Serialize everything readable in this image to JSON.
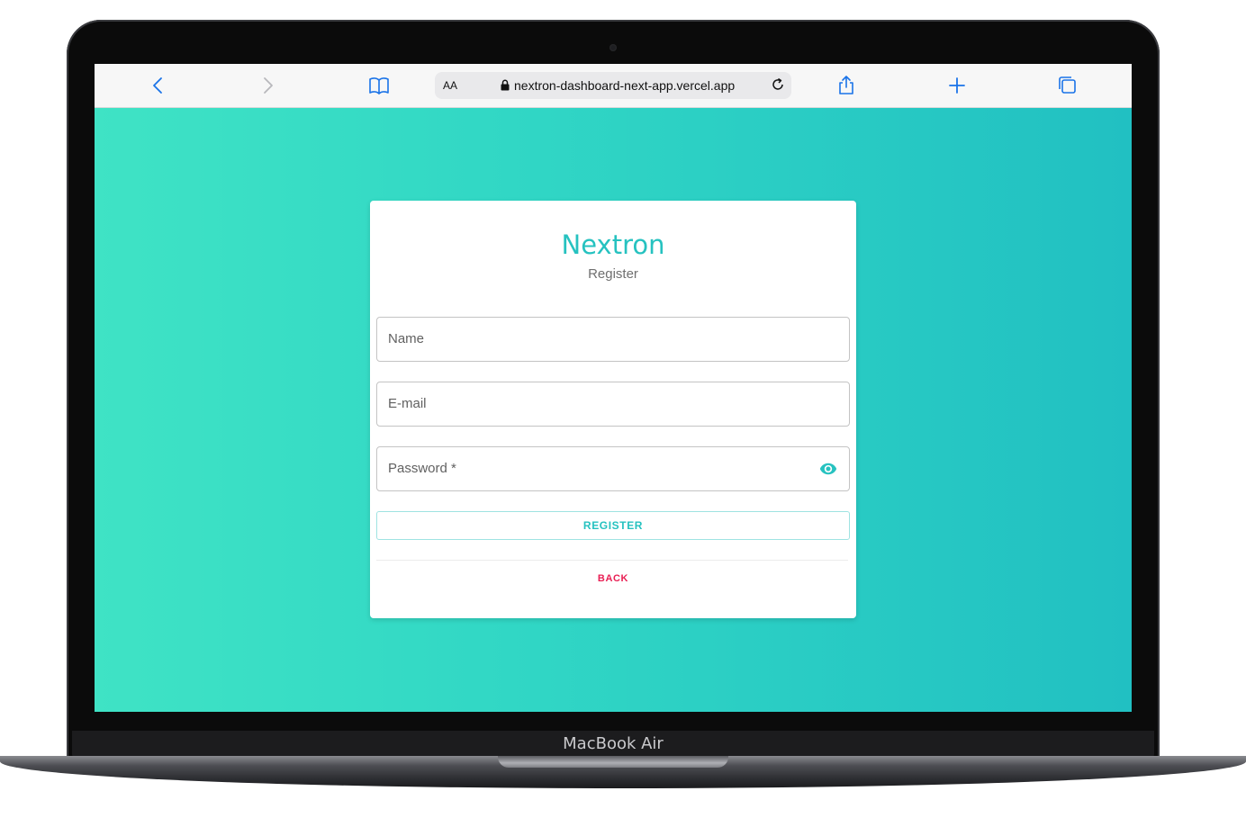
{
  "device": {
    "model_label": "MacBook Air"
  },
  "browser": {
    "text_size_label": "AA",
    "url": "nextron-dashboard-next-app.vercel.app",
    "icons": {
      "back": "chevron-left-icon",
      "forward": "chevron-right-icon",
      "bookmarks": "book-icon",
      "lock": "lock-icon",
      "reload": "reload-icon",
      "share": "share-icon",
      "new_tab": "plus-icon",
      "tabs": "tabs-icon"
    },
    "accent_color": "#1a73e8"
  },
  "register": {
    "brand": "Nextron",
    "subtitle": "Register",
    "name_label": "Name",
    "email_label": "E-mail",
    "password_label": "Password *",
    "password_toggle_icon": "eye-icon",
    "register_button": "REGISTER",
    "back_button": "BACK"
  },
  "colors": {
    "brand": "#26c2c0",
    "back_link": "#e91e53",
    "background_gradient_start": "#3fe3c5",
    "background_gradient_end": "#21c0c2"
  }
}
